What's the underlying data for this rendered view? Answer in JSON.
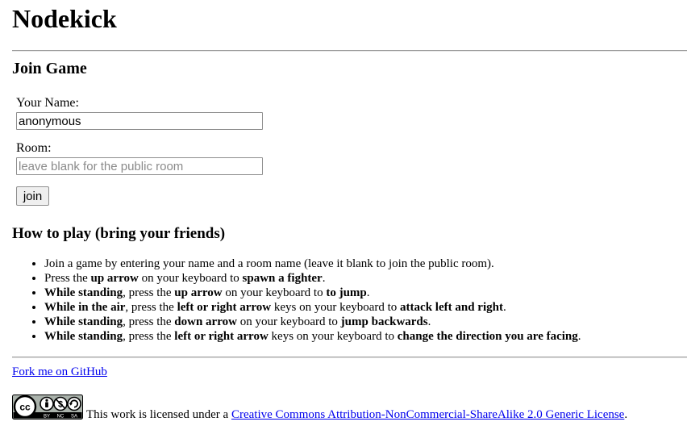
{
  "header": {
    "title": "Nodekick"
  },
  "join": {
    "heading": "Join Game",
    "name_label": "Your Name:",
    "name_value": "anonymous",
    "room_label": "Room:",
    "room_value": "",
    "room_placeholder": "leave blank for the public room",
    "button_label": "join"
  },
  "how_to_play": {
    "heading": "How to play (bring your friends)",
    "rules": [
      [
        {
          "t": "Join a game by entering your name and a room name (leave it blank to join the public room).",
          "b": false
        }
      ],
      [
        {
          "t": "Press the ",
          "b": false
        },
        {
          "t": "up arrow",
          "b": true
        },
        {
          "t": " on your keyboard to ",
          "b": false
        },
        {
          "t": "spawn a fighter",
          "b": true
        },
        {
          "t": ".",
          "b": false
        }
      ],
      [
        {
          "t": "While standing",
          "b": true
        },
        {
          "t": ", press the ",
          "b": false
        },
        {
          "t": "up arrow",
          "b": true
        },
        {
          "t": " on your keyboard to ",
          "b": false
        },
        {
          "t": "to jump",
          "b": true
        },
        {
          "t": ".",
          "b": false
        }
      ],
      [
        {
          "t": "While in the air",
          "b": true
        },
        {
          "t": ", press the ",
          "b": false
        },
        {
          "t": "left or right arrow",
          "b": true
        },
        {
          "t": " keys on your keyboard to ",
          "b": false
        },
        {
          "t": "attack left and right",
          "b": true
        },
        {
          "t": ".",
          "b": false
        }
      ],
      [
        {
          "t": "While standing",
          "b": true
        },
        {
          "t": ", press the ",
          "b": false
        },
        {
          "t": "down arrow",
          "b": true
        },
        {
          "t": " on your keyboard to ",
          "b": false
        },
        {
          "t": "jump backwards",
          "b": true
        },
        {
          "t": ".",
          "b": false
        }
      ],
      [
        {
          "t": "While standing",
          "b": true
        },
        {
          "t": ", press the ",
          "b": false
        },
        {
          "t": "left or right arrow",
          "b": true
        },
        {
          "t": " keys on your keyboard to ",
          "b": false
        },
        {
          "t": "change the direction you are facing",
          "b": true
        },
        {
          "t": ".",
          "b": false
        }
      ]
    ]
  },
  "footer": {
    "github_link": "Fork me on GitHub",
    "license_prefix": "This work is licensed under a ",
    "license_link": "Creative Commons Attribution-NonCommercial-ShareAlike 2.0 Generic License",
    "license_suffix": ".",
    "badge": {
      "icon": "creative-commons-by-nc-sa-badge",
      "cc_mark": "cc",
      "terms": [
        "BY",
        "NC",
        "SA"
      ],
      "colors": {
        "light": "#aab2ab",
        "dark": "#000000",
        "white": "#ffffff"
      }
    }
  }
}
